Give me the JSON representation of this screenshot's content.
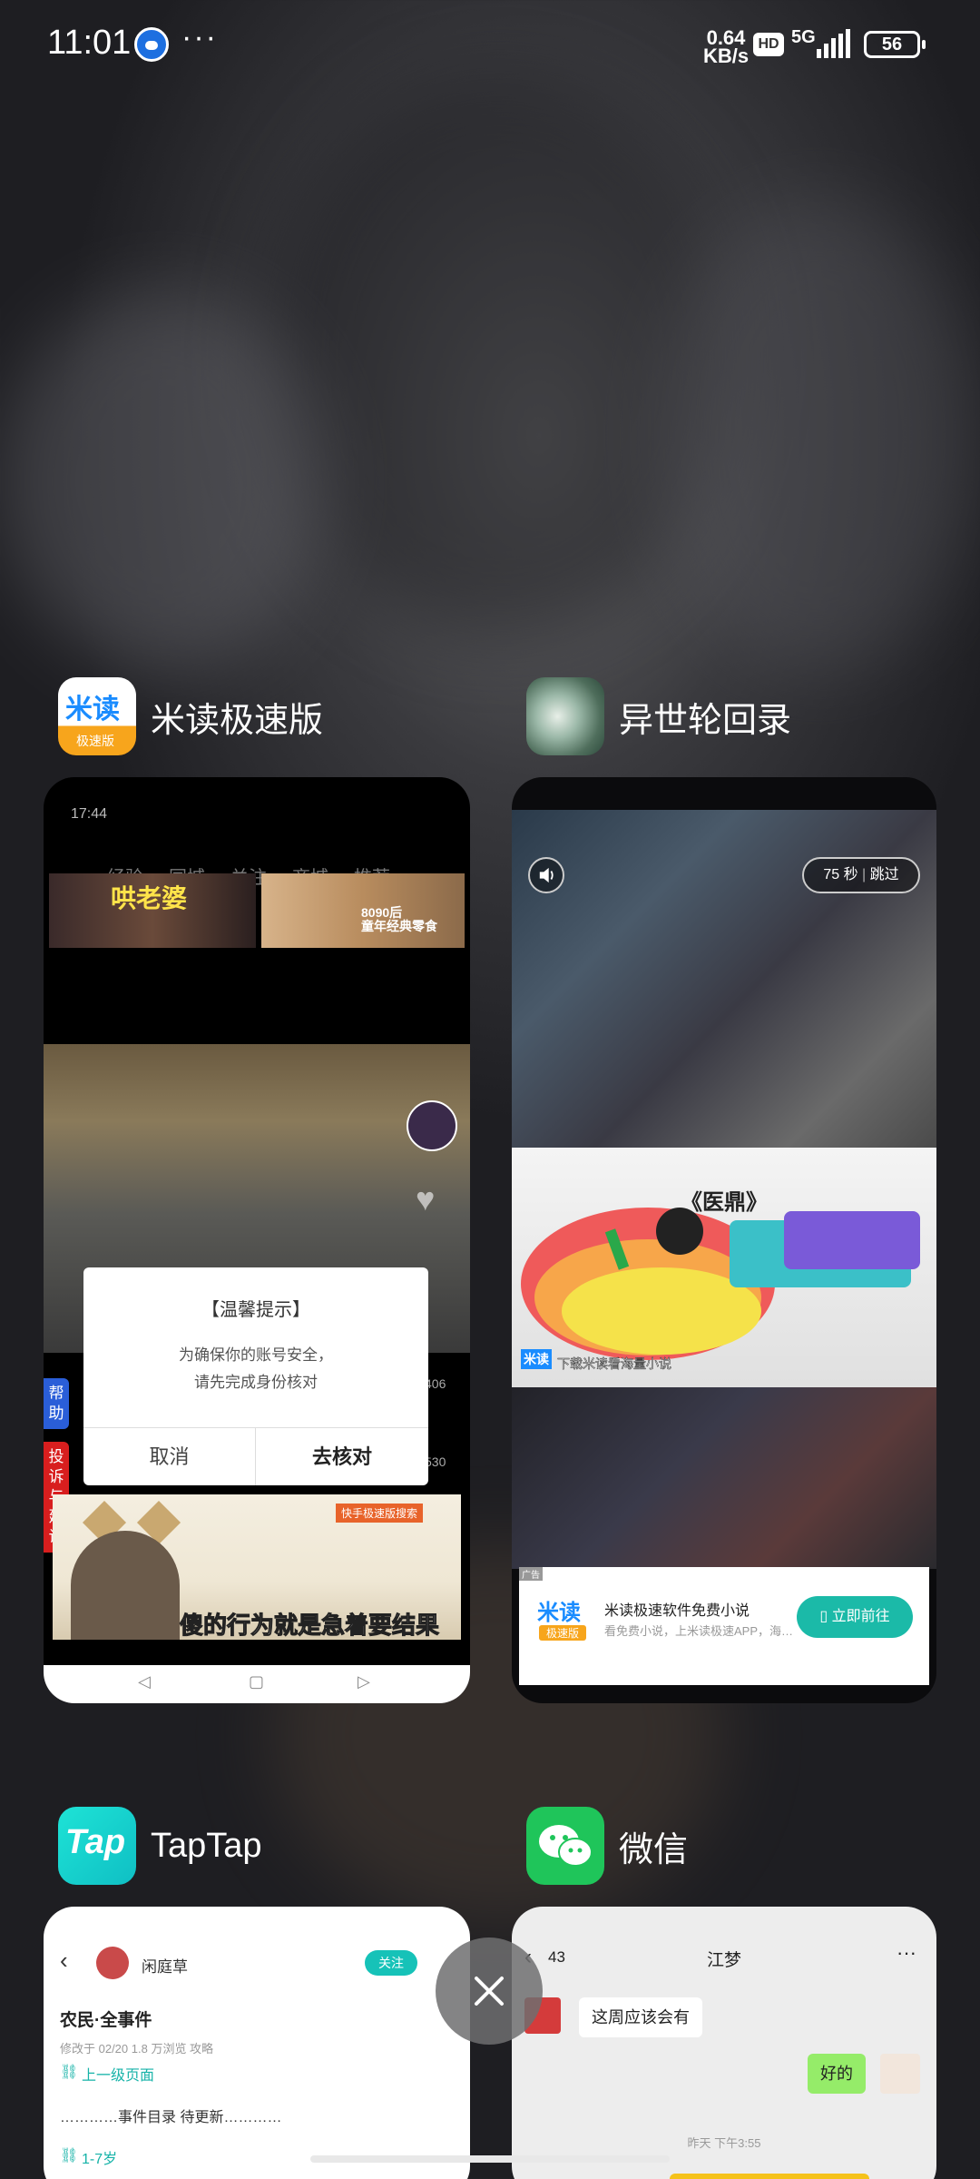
{
  "status_bar": {
    "time": "11:01",
    "more": "···",
    "net_speed": "0.64\nKB/s",
    "hd": "HD",
    "network": "5G",
    "battery": "56"
  },
  "apps": [
    {
      "name": "米读极速版",
      "icon_text": "米读",
      "icon_subtext": "极速版",
      "screen": {
        "time": "17:44",
        "tabs": [
          "经验",
          "同城",
          "关注",
          "商城",
          "推荐"
        ],
        "thumb1_caption": "哄老婆",
        "thumb2_caption": "8090后\n童年经典零食",
        "like_count": "406",
        "share_count": "530",
        "dialog": {
          "title": "【温馨提示】",
          "message_line1": "为确保你的账号安全，",
          "message_line2": "请先完成身份核对",
          "cancel": "取消",
          "confirm": "去核对"
        },
        "side_help": "帮助",
        "side_feedback": "投诉与建议",
        "bottom_banner": "快手极速版搜索",
        "bottom_caption": "傻的行为就是急着要结果"
      }
    },
    {
      "name": "异世轮回录",
      "screen": {
        "countdown": "75 秒",
        "skip": "跳过",
        "banner_title": "《医鼎》",
        "banner_sub": "下载米读看海量小说",
        "banner_logo": "米读",
        "ad_logo": "米读",
        "ad_logo_sub": "极速版",
        "ad_title": "米读极速软件免费小说",
        "ad_subtitle": "看免费小说，上米读极速APP，海量小说免费看",
        "ad_cta": "立即前往",
        "tag": "广告"
      }
    },
    {
      "name": "TapTap",
      "icon_text": "Tap",
      "screen": {
        "author": "闲庭草",
        "follow": "关注",
        "title": "农民·全事件",
        "meta": "修改于 02/20  1.8 万浏览  攻略",
        "link1": "上一级页面",
        "body": "…………事件目录 待更新…………",
        "link2": "1-7岁"
      }
    },
    {
      "name": "微信",
      "screen": {
        "back_count": "43",
        "chat_title": "江梦",
        "more": "···",
        "msg_in": "这周应该会有",
        "msg_out": "好的",
        "timestamp": "昨天 下午3:55"
      }
    }
  ],
  "close_icon": "close-icon"
}
